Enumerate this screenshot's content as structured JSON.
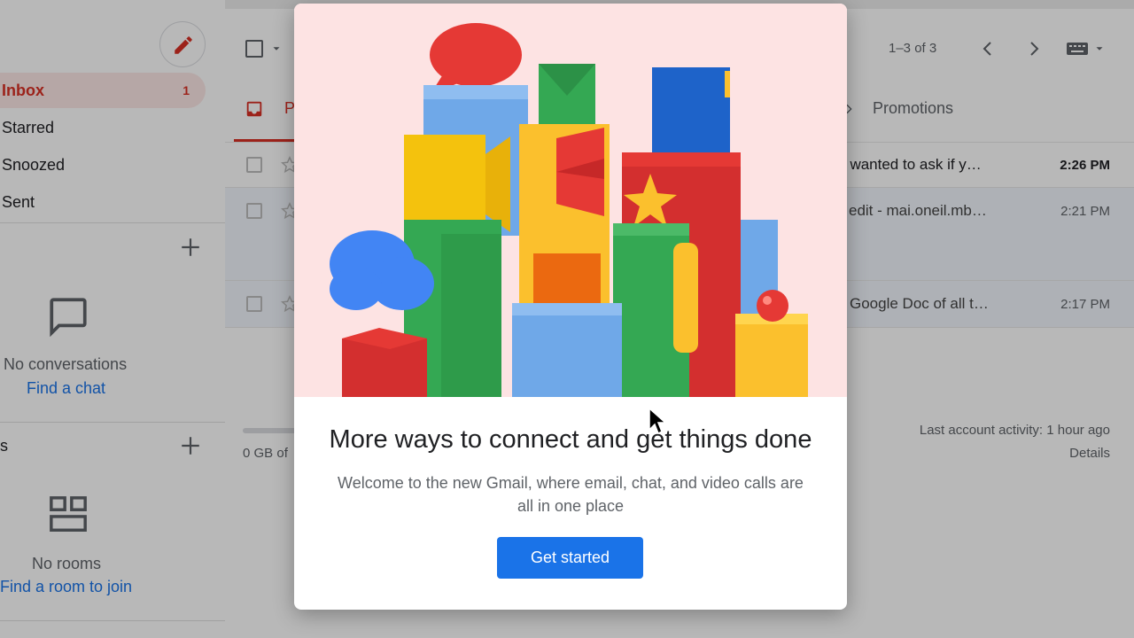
{
  "sidebar": {
    "nav": [
      {
        "label": "Inbox",
        "count": "1",
        "active": true
      },
      {
        "label": "Starred"
      },
      {
        "label": "Snoozed"
      },
      {
        "label": "Sent"
      }
    ],
    "chat": {
      "empty_text": "No conversations",
      "link": "Find a chat"
    },
    "rooms": {
      "header_fragment": "s",
      "empty_text": "No rooms",
      "link": "Find a room to join"
    }
  },
  "toolbar": {
    "pagination": "1–3 of 3"
  },
  "tabs": {
    "primary_fragment": "P",
    "promotions": "Promotions"
  },
  "emails": [
    {
      "snippet": "t wanted to ask if y…",
      "time": "2:26 PM",
      "unread": true
    },
    {
      "snippet": "edit - mai.oneil.mb…",
      "time": "2:21 PM",
      "unread": false
    },
    {
      "snippet": "Google Doc of all t…",
      "time": "2:17 PM",
      "unread": false
    }
  ],
  "footer": {
    "storage_fragment": "0 GB of",
    "activity": "Last account activity: 1 hour ago",
    "details": "Details"
  },
  "modal": {
    "title": "More ways to connect and get things done",
    "body": "Welcome to the new Gmail, where email, chat, and video calls are all in one place",
    "button": "Get started"
  },
  "colors": {
    "accent_red": "#d93025",
    "link_blue": "#1a73e8",
    "hero_background": "#fde3e3",
    "google_blue": "#4285f4",
    "google_red": "#ea4335",
    "google_yellow": "#fbbc04",
    "google_green": "#34a853"
  }
}
